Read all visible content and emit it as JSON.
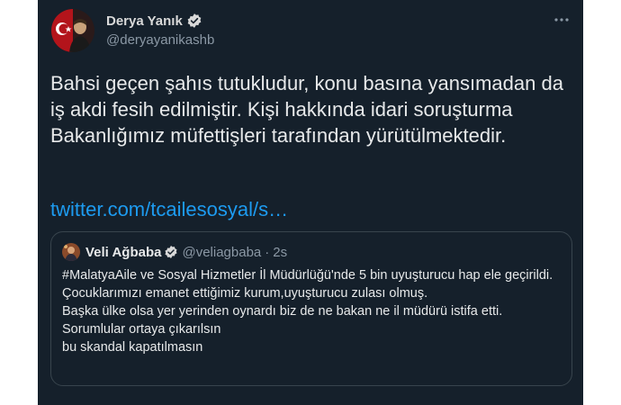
{
  "author": {
    "name": "Derya Yanık",
    "handle": "@deryayanikashb"
  },
  "tweet": {
    "text": "Bahsi geçen şahıs tutukludur, konu basına yansımadan da iş akdi fesih edilmiştir. Kişi hakkında idari soruşturma Bakanlığımız müfettişleri tarafından yürütülmektedir.",
    "link": "twitter.com/tcailesosyal/s…"
  },
  "quoted": {
    "name": "Veli Ağbaba",
    "handle": "@veliagbaba",
    "separator": "·",
    "time": "2s",
    "lines": [
      "#MalatyaAile ve Sosyal Hizmetler İl Müdürlüğü'nde 5 bin uyuşturucu hap ele geçirildi.",
      "Çocuklarımızı emanet ettiğimiz kurum,uyuşturucu zulası olmuş.",
      "Başka ülke olsa yer yerinden oynardı biz de ne bakan ne il müdürü istifa etti.",
      "Sorumlular ortaya çıkarılsın",
      "bu skandal kapatılmasın"
    ]
  },
  "icons": {
    "verified": "verified-badge-icon",
    "more": "more-options-icon"
  },
  "colors": {
    "background": "#15202b",
    "text": "#e7e9ea",
    "secondary": "#8b98a5",
    "link": "#1d9bf0",
    "border": "#38444d"
  }
}
